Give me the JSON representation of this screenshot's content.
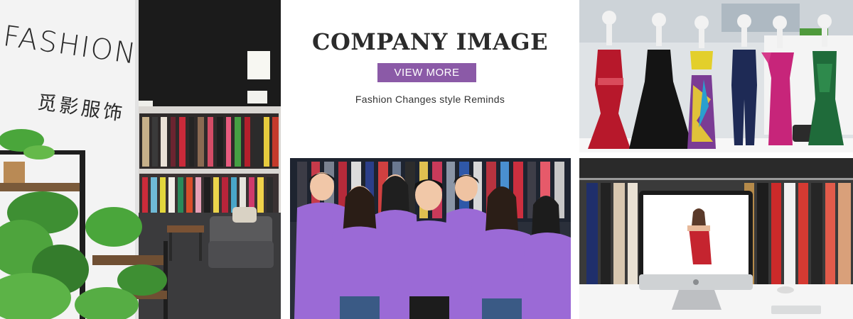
{
  "showroom": {
    "brand_en": "FASHION",
    "brand_cn": "觅影服饰"
  },
  "intro": {
    "title": "COMPANY IMAGE",
    "button_label": "VIEW MORE",
    "slogan": "Fashion Changes style Reminds"
  },
  "colors": {
    "accent": "#8b5aa7",
    "uniform": "#9b6ad6"
  },
  "icons": {
    "computer": "apple-logo-icon"
  }
}
